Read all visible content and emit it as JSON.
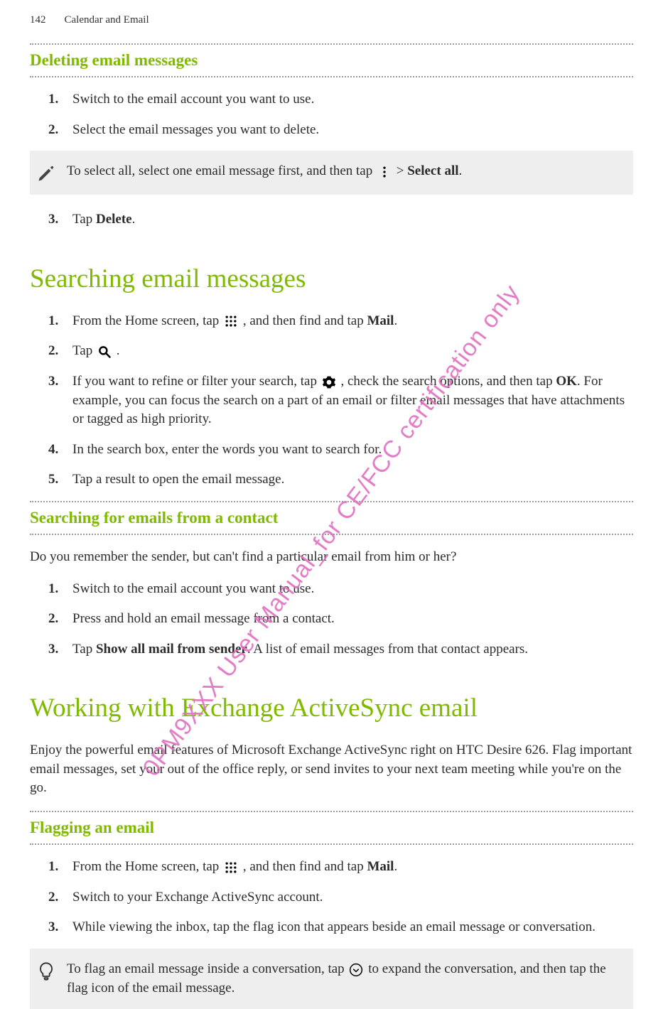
{
  "header": {
    "page_number": "142",
    "section": "Calendar and Email"
  },
  "section1": {
    "title": "Deleting email messages",
    "steps": [
      "Switch to the email account you want to use.",
      "Select the email messages you want to delete."
    ],
    "note_before": "To select all, select one email message first, and then tap ",
    "note_mid": " > ",
    "note_bold": "Select all",
    "note_end": ".",
    "step3_pre": "Tap ",
    "step3_bold": "Delete",
    "step3_end": "."
  },
  "section2": {
    "title": "Searching email messages",
    "step1_pre": "From the Home screen, tap ",
    "step1_mid": " , and then find and tap ",
    "step1_bold": "Mail",
    "step1_end": ".",
    "step2_pre": "Tap ",
    "step2_end": " .",
    "step3_pre": "If you want to refine or filter your search, tap ",
    "step3_mid": " , check the search options, and then tap ",
    "step3_bold": "OK",
    "step3_rest": ". For example, you can focus the search on a part of an email or filter email messages that have attachments or tagged as high priority.",
    "step4": "In the search box, enter the words you want to search for.",
    "step5": "Tap a result to open the email message."
  },
  "section3": {
    "title": "Searching for emails from a contact",
    "intro": "Do you remember the sender, but can't find a particular email from him or her?",
    "steps12": [
      "Switch to the email account you want to use.",
      "Press and hold an email message from a contact."
    ],
    "step3_pre": "Tap ",
    "step3_bold": "Show all mail from sender",
    "step3_end": ". A list of email messages from that contact appears."
  },
  "section4": {
    "title": "Working with Exchange ActiveSync email",
    "intro": "Enjoy the powerful email features of Microsoft Exchange ActiveSync right on HTC Desire 626. Flag important email messages, set your out of the office reply, or send invites to your next team meeting while you're on the go."
  },
  "section5": {
    "title": "Flagging an email",
    "step1_pre": "From the Home screen, tap ",
    "step1_mid": " , and then find and tap ",
    "step1_bold": "Mail",
    "step1_end": ".",
    "step2": "Switch to your Exchange ActiveSync account.",
    "step3": "While viewing the inbox, tap the flag icon that appears beside an email message or conversation.",
    "note_pre": "To flag an email message inside a conversation, tap ",
    "note_end": " to expand the conversation, and then tap the flag icon of the email message."
  },
  "watermark": "0PM9XXX User Manual_for CE/FCC certification only"
}
